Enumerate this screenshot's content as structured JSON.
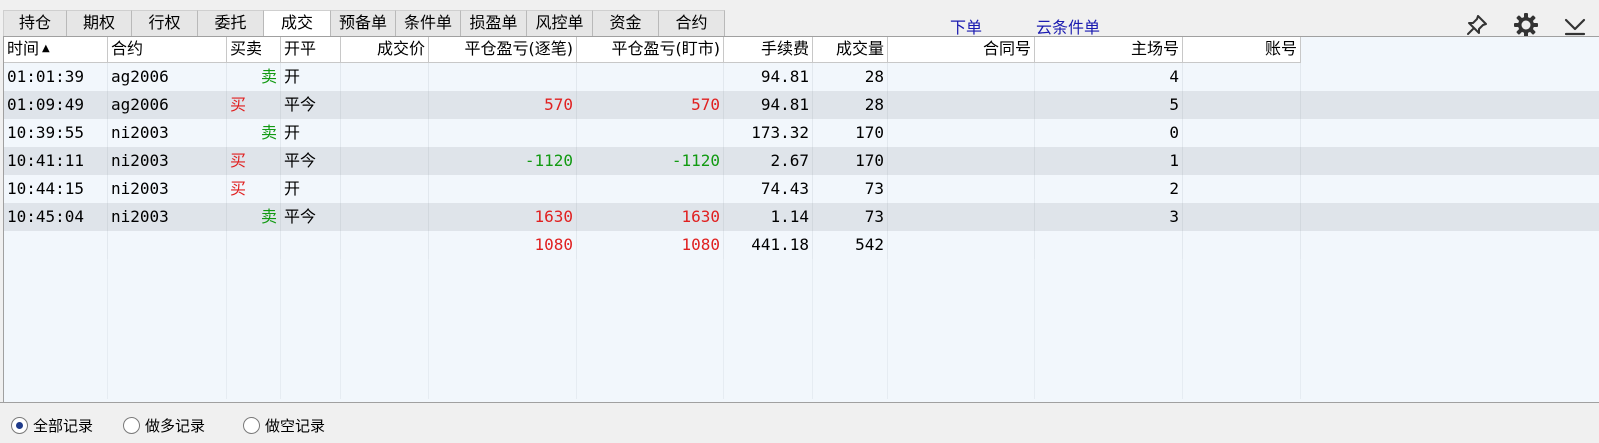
{
  "tabs": [
    {
      "label": "持仓",
      "active": false
    },
    {
      "label": "期权",
      "active": false
    },
    {
      "label": "行权",
      "active": false
    },
    {
      "label": "委托",
      "active": false
    },
    {
      "label": "成交",
      "active": true
    },
    {
      "label": "预备单",
      "active": false
    },
    {
      "label": "条件单",
      "active": false
    },
    {
      "label": "损盈单",
      "active": false
    },
    {
      "label": "风控单",
      "active": false
    },
    {
      "label": "资金",
      "active": false
    },
    {
      "label": "合约",
      "active": false
    }
  ],
  "links": {
    "order": "下单",
    "cloud_condition": "云条件单"
  },
  "icons": {
    "pin": "pin-icon",
    "settings": "gear-icon",
    "collapse": "chevron-down-icon"
  },
  "columns": {
    "time": "时间",
    "contract": "合约",
    "direction": "买卖",
    "offset": "开平",
    "price": "成交价",
    "pnl_trade": "平仓盈亏(逐笔)",
    "pnl_market": "平仓盈亏(盯市)",
    "fee": "手续费",
    "volume": "成交量",
    "contract_no": "合同号",
    "exchange_no": "主场号",
    "account": "账号"
  },
  "rows": [
    {
      "time": "01:01:39",
      "contract": "ag2006",
      "direction": "卖",
      "offset": "开",
      "price": "",
      "pnl_trade": "",
      "pnl_market": "",
      "fee": "94.81",
      "volume": "28",
      "contract_no": "",
      "exchange_no": "4",
      "account": ""
    },
    {
      "time": "01:09:49",
      "contract": "ag2006",
      "direction": "买",
      "offset": "平今",
      "price": "",
      "pnl_trade": "570",
      "pnl_market": "570",
      "fee": "94.81",
      "volume": "28",
      "contract_no": "",
      "exchange_no": "5",
      "account": ""
    },
    {
      "time": "10:39:55",
      "contract": "ni2003",
      "direction": "卖",
      "offset": "开",
      "price": "",
      "pnl_trade": "",
      "pnl_market": "",
      "fee": "173.32",
      "volume": "170",
      "contract_no": "",
      "exchange_no": "0",
      "account": ""
    },
    {
      "time": "10:41:11",
      "contract": "ni2003",
      "direction": "买",
      "offset": "平今",
      "price": "",
      "pnl_trade": "-1120",
      "pnl_market": "-1120",
      "fee": "2.67",
      "volume": "170",
      "contract_no": "",
      "exchange_no": "1",
      "account": ""
    },
    {
      "time": "10:44:15",
      "contract": "ni2003",
      "direction": "买",
      "offset": "开",
      "price": "",
      "pnl_trade": "",
      "pnl_market": "",
      "fee": "74.43",
      "volume": "73",
      "contract_no": "",
      "exchange_no": "2",
      "account": ""
    },
    {
      "time": "10:45:04",
      "contract": "ni2003",
      "direction": "卖",
      "offset": "平今",
      "price": "",
      "pnl_trade": "1630",
      "pnl_market": "1630",
      "fee": "1.14",
      "volume": "73",
      "contract_no": "",
      "exchange_no": "3",
      "account": ""
    }
  ],
  "totals": {
    "pnl_trade": "1080",
    "pnl_market": "1080",
    "fee": "441.18",
    "volume": "542"
  },
  "colors": {
    "buy": "#e02020",
    "sell": "#129a12",
    "loss": "#129a12",
    "profit": "#e02020",
    "link": "#1a1ab0"
  },
  "filters": [
    {
      "label": "全部记录",
      "checked": true
    },
    {
      "label": "做多记录",
      "checked": false
    },
    {
      "label": "做空记录",
      "checked": false
    }
  ]
}
